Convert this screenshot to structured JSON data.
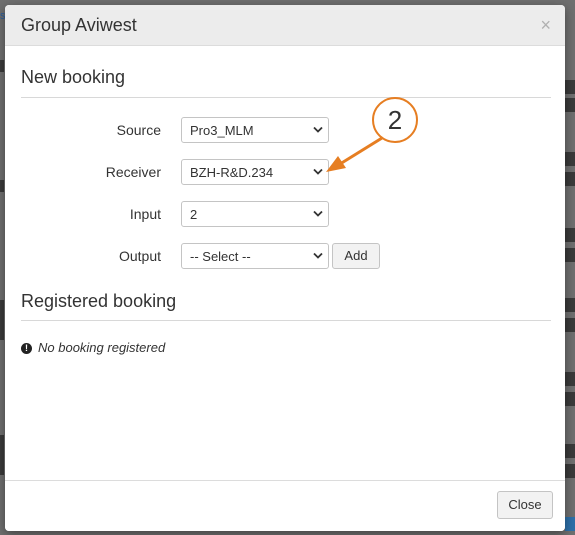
{
  "modal": {
    "title": "Group Aviwest",
    "close_glyph": "×"
  },
  "new_booking": {
    "heading": "New booking",
    "fields": [
      {
        "label": "Source",
        "value": "Pro3_MLM"
      },
      {
        "label": "Receiver",
        "value": "BZH-R&D.234"
      },
      {
        "label": "Input",
        "value": "2"
      },
      {
        "label": "Output",
        "value": "-- Select --"
      }
    ],
    "add_label": "Add"
  },
  "registered_booking": {
    "heading": "Registered booking",
    "empty_message": "No booking registered",
    "info_glyph": "!"
  },
  "footer": {
    "close_label": "Close"
  },
  "annotation": {
    "step_number": "2",
    "color": "#e67e22"
  },
  "colors": {
    "header_bg": "#ececec",
    "overlay": "#6f6f6f"
  }
}
